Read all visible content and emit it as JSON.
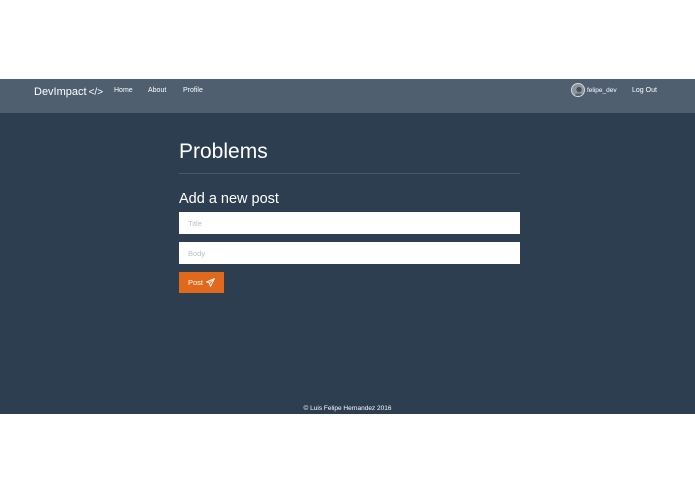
{
  "navbar": {
    "brand": "DevImpact",
    "brand_code": "</>",
    "links": [
      {
        "label": "Home"
      },
      {
        "label": "About"
      },
      {
        "label": "Profile"
      }
    ],
    "user": {
      "name": "felipe_dev",
      "avatar_icon": "user-avatar"
    },
    "logout_label": "Log Out"
  },
  "main": {
    "title": "Problems",
    "form": {
      "heading": "Add a new post",
      "title_field": {
        "value": "",
        "placeholder": "Title"
      },
      "body_field": {
        "value": "",
        "placeholder": "Body"
      },
      "submit": {
        "label": "Post",
        "icon": "paper-plane-icon"
      }
    }
  },
  "footer": {
    "text": "© Luis Felipe Hernandez 2016"
  },
  "colors": {
    "background": "#2c3e50",
    "navbar": "#4f5f6f",
    "accent": "#e0691c",
    "text": "#ffffff"
  }
}
